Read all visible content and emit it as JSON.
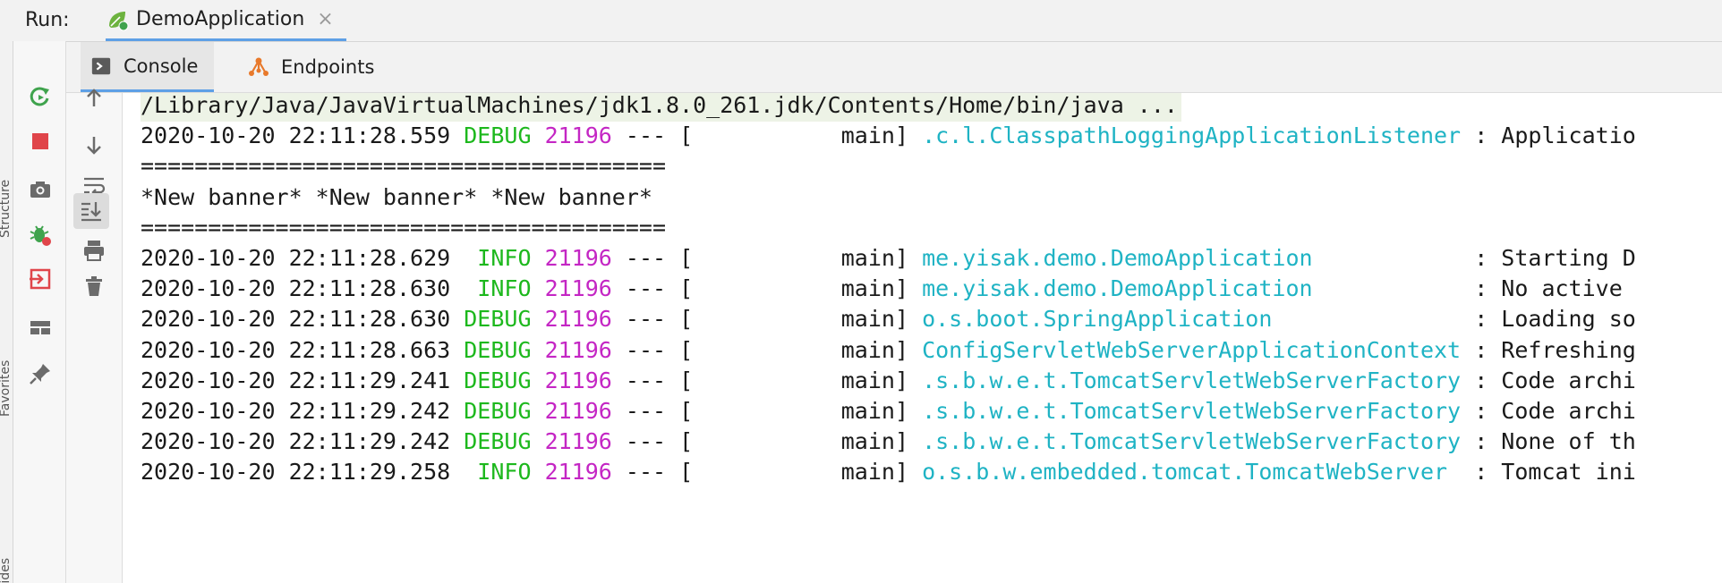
{
  "run_header": {
    "label": "Run:",
    "tab_title": "DemoApplication",
    "close_glyph": "×"
  },
  "side_gutter": {
    "labels": [
      "Structure",
      "Favorites",
      "...ides"
    ]
  },
  "tabs": [
    {
      "label": "Console",
      "icon": "console-icon",
      "active": true
    },
    {
      "label": "Endpoints",
      "icon": "endpoints-icon",
      "active": false
    }
  ],
  "outer_toolbar": [
    {
      "name": "rerun-icon",
      "color": "#3fa34d"
    },
    {
      "name": "stop-icon",
      "color": "#e0454a"
    },
    {
      "name": "camera-icon",
      "color": "#6b6b6b"
    },
    {
      "name": "debug-bug-icon",
      "color": "#3fa34d"
    },
    {
      "name": "exit-icon",
      "color": "#e0454a"
    },
    {
      "name": "layout-icon",
      "color": "#6b6b6b"
    },
    {
      "name": "pin-icon",
      "color": "#6b6b6b"
    }
  ],
  "inner_toolbar": [
    {
      "name": "up-arrow-icon"
    },
    {
      "name": "down-arrow-icon"
    },
    {
      "name": "soft-wrap-icon"
    },
    {
      "name": "scroll-to-end-icon",
      "active": true
    },
    {
      "name": "print-icon"
    },
    {
      "name": "trash-icon"
    }
  ],
  "colors": {
    "debug_info_level": "#1db81d",
    "pid": "#c426c4",
    "logger": "#1fb3c4",
    "command_bg": "#edf3e6",
    "tab_accent": "#5ea0e6"
  },
  "console": {
    "command": "/Library/Java/JavaVirtualMachines/jdk1.8.0_261.jdk/Contents/Home/bin/java ...",
    "banner": [
      "=======================================",
      "*New banner* *New banner* *New banner*",
      "======================================="
    ],
    "log_lines": [
      {
        "ts": "2020-10-20 22:11:28.559",
        "level": "DEBUG",
        "pid": "21196",
        "sep": "---",
        "thread": "[           main]",
        "logger": ".c.l.ClasspathLoggingApplicationListener",
        "msg": ": Applicatio"
      },
      {
        "ts": "2020-10-20 22:11:28.629",
        "level": " INFO",
        "pid": "21196",
        "sep": "---",
        "thread": "[           main]",
        "logger": "me.yisak.demo.DemoApplication           ",
        "msg": ": Starting D"
      },
      {
        "ts": "2020-10-20 22:11:28.630",
        "level": " INFO",
        "pid": "21196",
        "sep": "---",
        "thread": "[           main]",
        "logger": "me.yisak.demo.DemoApplication           ",
        "msg": ": No active"
      },
      {
        "ts": "2020-10-20 22:11:28.630",
        "level": "DEBUG",
        "pid": "21196",
        "sep": "---",
        "thread": "[           main]",
        "logger": "o.s.boot.SpringApplication              ",
        "msg": ": Loading so"
      },
      {
        "ts": "2020-10-20 22:11:28.663",
        "level": "DEBUG",
        "pid": "21196",
        "sep": "---",
        "thread": "[           main]",
        "logger": "ConfigServletWebServerApplicationContext",
        "msg": ": Refreshing"
      },
      {
        "ts": "2020-10-20 22:11:29.241",
        "level": "DEBUG",
        "pid": "21196",
        "sep": "---",
        "thread": "[           main]",
        "logger": ".s.b.w.e.t.TomcatServletWebServerFactory",
        "msg": ": Code archi"
      },
      {
        "ts": "2020-10-20 22:11:29.242",
        "level": "DEBUG",
        "pid": "21196",
        "sep": "---",
        "thread": "[           main]",
        "logger": ".s.b.w.e.t.TomcatServletWebServerFactory",
        "msg": ": Code archi"
      },
      {
        "ts": "2020-10-20 22:11:29.242",
        "level": "DEBUG",
        "pid": "21196",
        "sep": "---",
        "thread": "[           main]",
        "logger": ".s.b.w.e.t.TomcatServletWebServerFactory",
        "msg": ": None of th"
      },
      {
        "ts": "2020-10-20 22:11:29.258",
        "level": " INFO",
        "pid": "21196",
        "sep": "---",
        "thread": "[           main]",
        "logger": "o.s.b.w.embedded.tomcat.TomcatWebServer ",
        "msg": ": Tomcat ini"
      }
    ]
  }
}
